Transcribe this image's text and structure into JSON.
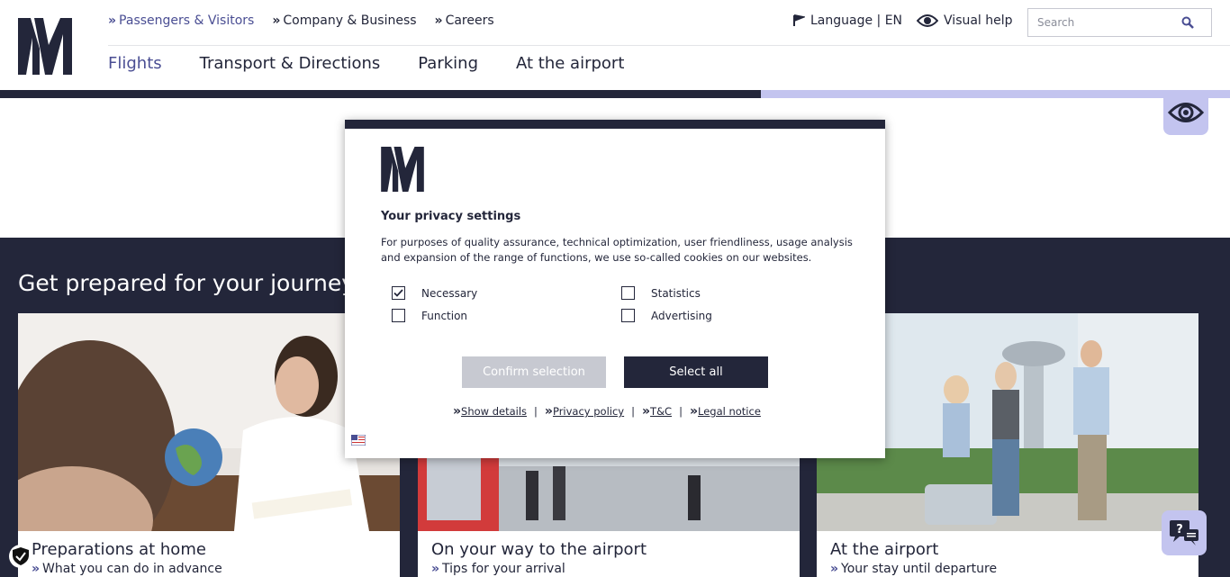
{
  "brand": {
    "dark": "#23263a",
    "accent": "#4a4e93",
    "light": "#c3c4ef"
  },
  "topnav": [
    {
      "label": "Passengers & Visitors",
      "active": true
    },
    {
      "label": "Company & Business",
      "active": false
    },
    {
      "label": "Careers",
      "active": false
    }
  ],
  "topright": {
    "language": "Language | EN",
    "visual_help": "Visual help"
  },
  "search": {
    "placeholder": "Search"
  },
  "mainnav": [
    {
      "label": "Flights",
      "active": true
    },
    {
      "label": "Transport & Directions",
      "active": false
    },
    {
      "label": "Parking",
      "active": false
    },
    {
      "label": "At the airport",
      "active": false
    }
  ],
  "section": {
    "title": "Get prepared for your journey"
  },
  "cards": [
    {
      "title": "Preparations at home",
      "subtitle": "What you can do in advance"
    },
    {
      "title": "On your way to the airport",
      "subtitle": "Tips for your arrival"
    },
    {
      "title": "At the airport",
      "subtitle": "Your stay until departure"
    }
  ],
  "modal": {
    "title": "Your privacy settings",
    "description": "For purposes of quality assurance, technical optimization, user friendliness, usage analysis and expansion of the range of functions, we use so-called cookies on our websites.",
    "options": [
      {
        "label": "Necessary",
        "checked": true
      },
      {
        "label": "Statistics",
        "checked": false
      },
      {
        "label": "Function",
        "checked": false
      },
      {
        "label": "Advertising",
        "checked": false
      }
    ],
    "confirm_label": "Confirm selection",
    "select_all_label": "Select all",
    "links": [
      "Show details",
      "Privacy policy",
      "T&C",
      "Legal notice"
    ]
  }
}
